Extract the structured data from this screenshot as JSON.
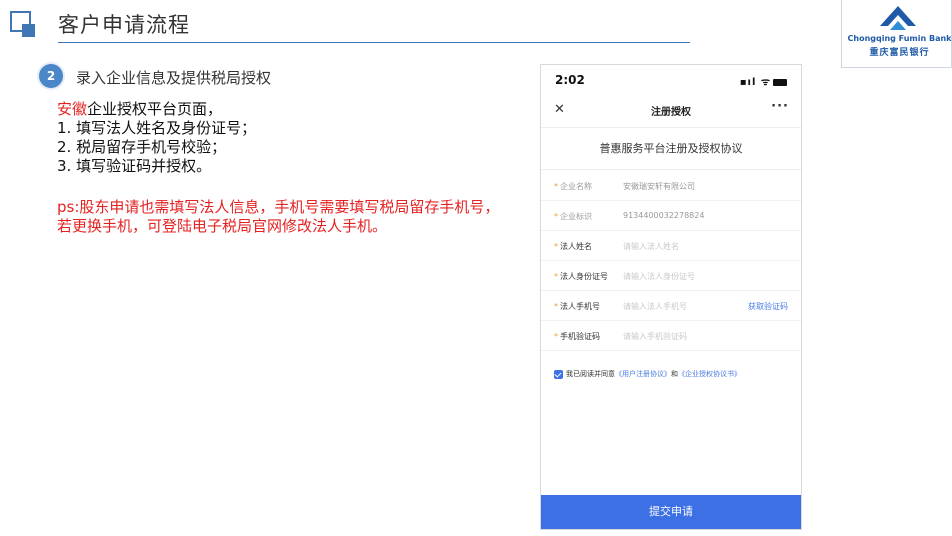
{
  "header": {
    "title": "客户申请流程"
  },
  "logo": {
    "en": "Chongqing Fumin Bank",
    "cn": "重庆富民银行",
    "color": "#1f5aa8"
  },
  "step": {
    "number": "2",
    "text": "录入企业信息及提供税局授权"
  },
  "instructions": {
    "province": "安徽",
    "line1_rest": "企业授权平台页面，",
    "items": [
      "1.  填写法人姓名及身份证号；",
      "2.  税局留存手机号校验；",
      "3.  填写验证码并授权。"
    ],
    "ps_line1": "ps:股东申请也需填写法人信息，手机号需要填写税局留存手机号，",
    "ps_line2": "若更换手机，可登陆电子税局官网修改法人手机。"
  },
  "phone": {
    "time": "2:02",
    "status_icons": "▪ıl ᯤ",
    "close_icon": "✕",
    "nav_title": "注册授权",
    "more_icon": "···",
    "agreement_title": "普惠服务平台注册及授权协议",
    "fields": [
      {
        "label": "企业名称",
        "value": "安徽瑞安轩有限公司",
        "placeholder": ""
      },
      {
        "label": "企业标识",
        "value": "9134400032278824",
        "placeholder": ""
      },
      {
        "label": "法人姓名",
        "value": "",
        "placeholder": "请输入法人姓名"
      },
      {
        "label": "法人身份证号",
        "value": "",
        "placeholder": "请输入法人身份证号"
      },
      {
        "label": "法人手机号",
        "value": "",
        "placeholder": "请输入法人手机号",
        "link": "获取验证码"
      },
      {
        "label": "手机验证码",
        "value": "",
        "placeholder": "请输入手机验证码"
      }
    ],
    "agree_prefix": "我已阅读并同意",
    "agree_link1": "《用户注册协议》",
    "agree_and": "和",
    "agree_link2": "《企业授权协议书》",
    "submit_label": "提交申请",
    "accent_color": "#3d6fe5"
  }
}
